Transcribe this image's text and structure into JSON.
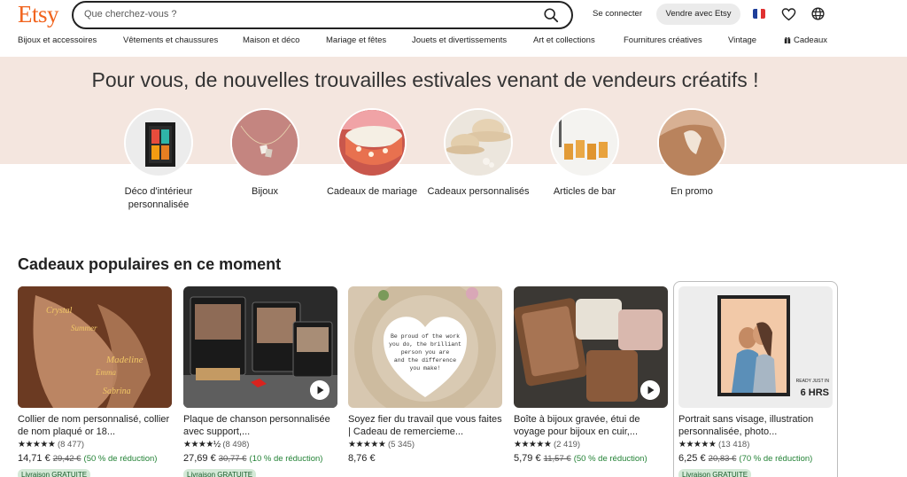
{
  "header": {
    "logo": "Etsy",
    "search_placeholder": "Que cherchez-vous ?",
    "signin_label": "Se connecter",
    "sell_label": "Vendre avec Etsy",
    "icons": [
      "search-icon",
      "flag-fr-icon",
      "heart-icon",
      "globe-icon"
    ]
  },
  "nav": {
    "items": [
      "Bijoux et accessoires",
      "Vêtements et chaussures",
      "Maison et déco",
      "Mariage et fêtes",
      "Jouets et divertissements",
      "Art et collections",
      "Fournitures créatives",
      "Vintage",
      "Cadeaux"
    ]
  },
  "hero": {
    "title": "Pour vous, de nouvelles trouvailles estivales venant de vendeurs créatifs !",
    "categories": [
      "Déco d'intérieur personnalisée",
      "Bijoux",
      "Cadeaux de mariage",
      "Cadeaux personnalisés",
      "Articles de bar",
      "En promo"
    ]
  },
  "popular": {
    "title": "Cadeaux populaires en ce moment",
    "products": [
      {
        "title": "Collier de nom personnalisé, collier de nom plaqué or 18...",
        "stars": "★★★★★",
        "reviews": "(8 477)",
        "price": "14,71 €",
        "old_price": "29,42 €",
        "discount": "(50 % de réduction)",
        "badge": "Livraison GRATUITE",
        "image_text": [
          "Crystal",
          "Summer",
          "Madeline",
          "Emma",
          "Sabrina"
        ]
      },
      {
        "title": "Plaque de chanson personnalisée avec support,...",
        "stars": "★★★★½",
        "reviews": "(8 498)",
        "price": "27,69 €",
        "old_price": "30,77 €",
        "discount": "(10 % de réduction)",
        "badge": "Livraison GRATUITE"
      },
      {
        "title": "Soyez fier du travail que vous faites | Cadeau de remercieme...",
        "stars": "★★★★★",
        "reviews": "(5 345)",
        "price": "8,76 €",
        "old_price": "",
        "discount": "",
        "badge": "",
        "image_text": [
          "Be proud of the work",
          "you do, the brilliant",
          "person you are",
          "and the difference",
          "you make!"
        ]
      },
      {
        "title": "Boîte à bijoux gravée, étui de voyage pour bijoux en cuir,...",
        "stars": "★★★★★",
        "reviews": "(2 419)",
        "price": "5,79 €",
        "old_price": "11,57 €",
        "discount": "(50 % de réduction)",
        "badge": ""
      },
      {
        "title": "Portrait sans visage, illustration personnalisée, photo...",
        "stars": "★★★★★",
        "reviews": "(13 418)",
        "price": "6,25 €",
        "old_price": "20,83 €",
        "discount": "(70 % de réduction)",
        "badge": "Livraison GRATUITE",
        "image_text": [
          "READY JUST IN",
          "6 HRS"
        ]
      }
    ]
  },
  "colors": {
    "brand": "#f1641e",
    "hero_bg": "#f4e6df",
    "discount_green": "#238236",
    "badge_bg": "#d4e9d7"
  }
}
